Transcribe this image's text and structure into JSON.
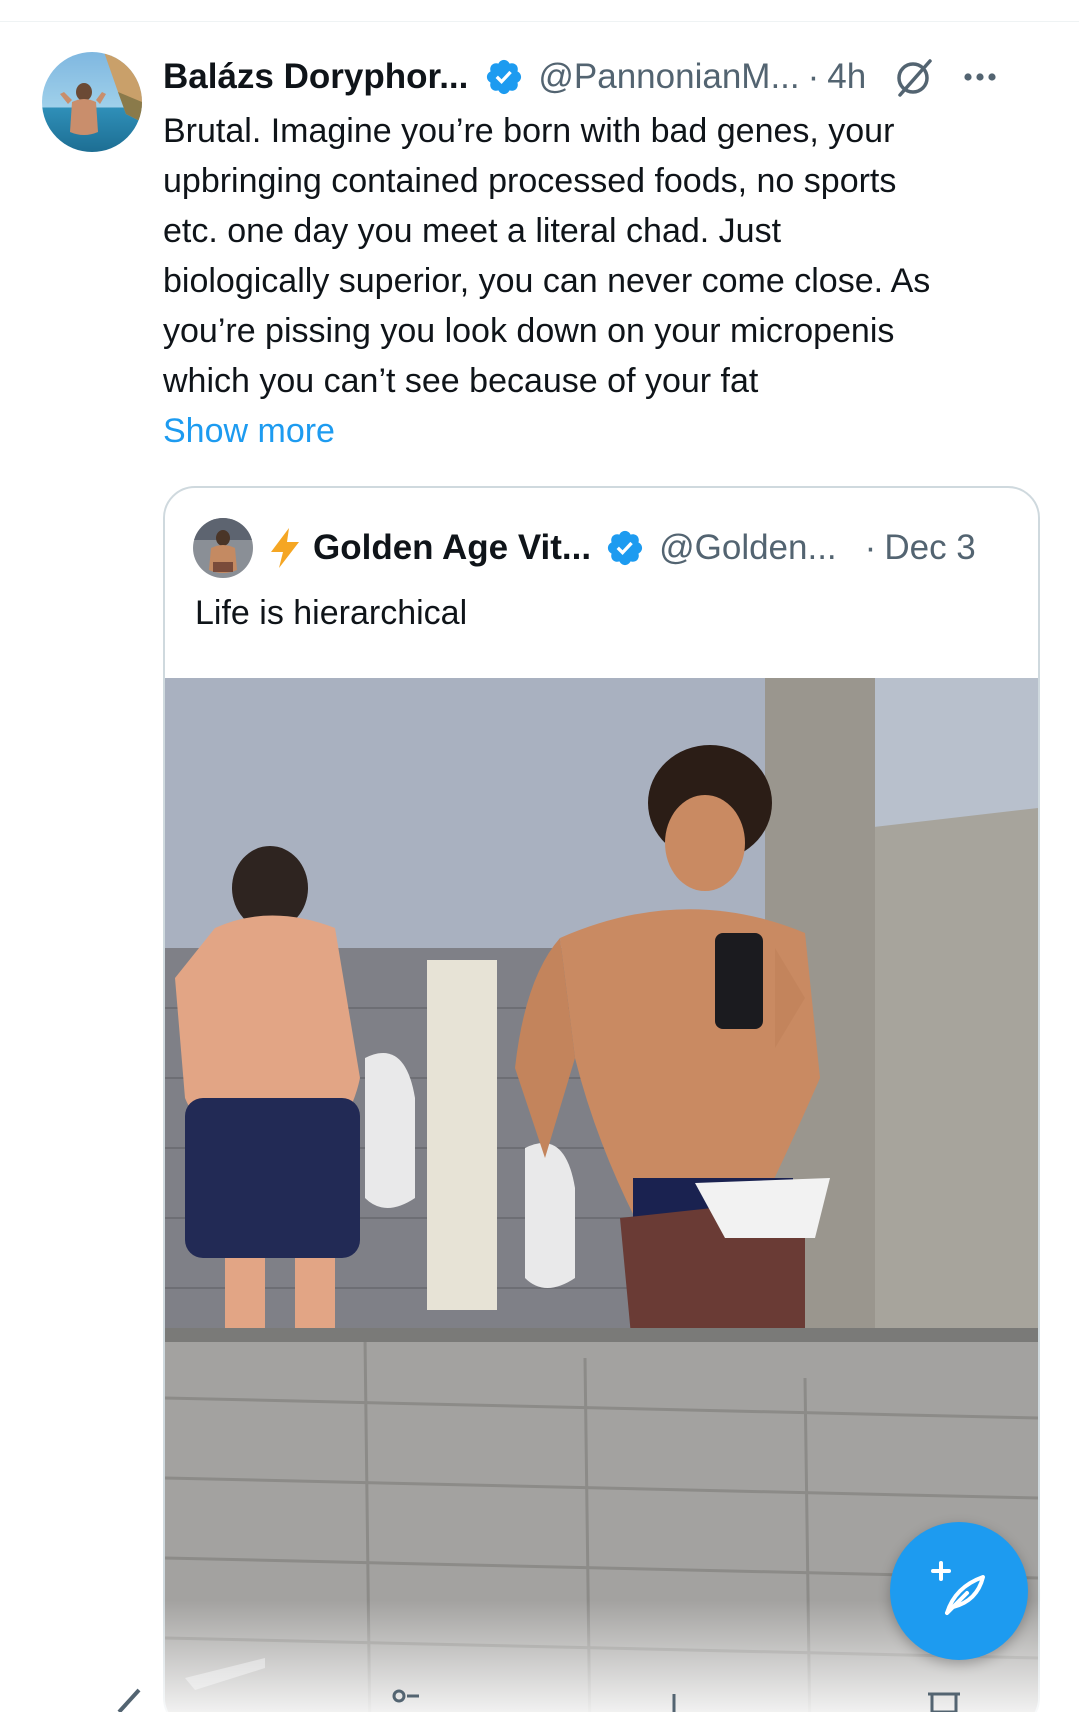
{
  "tweet": {
    "author_name": "Balázs Doryphor...",
    "handle": "@PannonianM...",
    "separator": "·",
    "time": "4h",
    "text": "Brutal. Imagine you’re born with bad genes, your\nupbringing contained processed foods, no sports\netc. one day you meet a literal chad. Just\nbiologically superior, you can never come close. As\nyou’re pissing you look down on your micropenis\nwhich you can’t see because of your fat",
    "show_more": "Show more"
  },
  "quoted_tweet": {
    "author_name": "Golden Age Vit...",
    "handle": "@Golden...",
    "separator": "·",
    "date": "Dec 3",
    "text": "Life is hierarchical"
  },
  "icons": {
    "verified": "verified-badge-icon",
    "grok": "grok-icon",
    "more": "more-icon",
    "bolt": "lightning-bolt-icon",
    "compose": "compose-post-icon"
  },
  "colors": {
    "accent": "#1d9bf0",
    "text": "#0f1419",
    "secondary": "#536471",
    "border": "#cfd9de"
  }
}
